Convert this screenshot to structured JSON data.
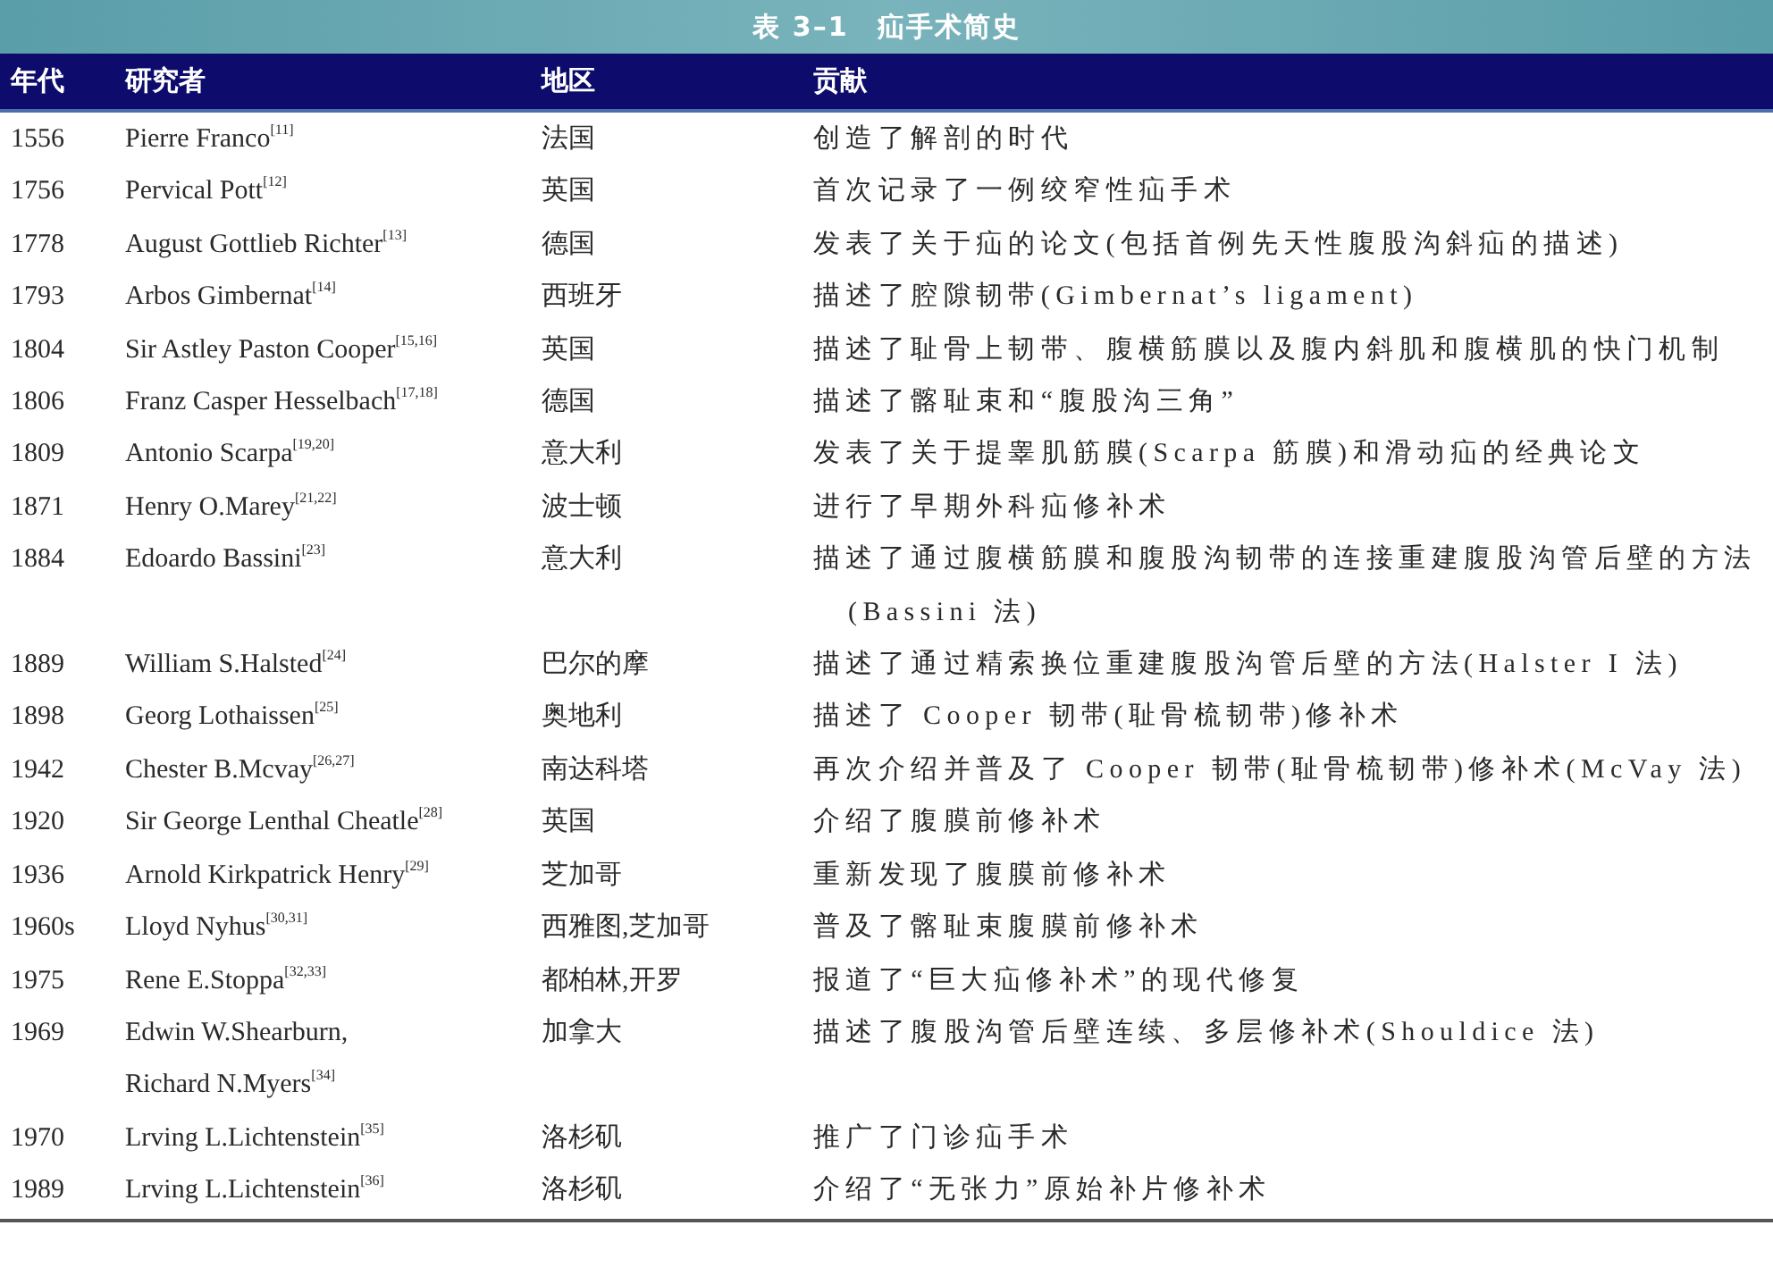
{
  "title": "表 3–1　疝手术简史",
  "columns": [
    "年代",
    "研究者",
    "地区",
    "贡献"
  ],
  "rows": [
    {
      "year": "1556",
      "researcher": "Pierre Franco$^{[11]}$",
      "region": "法国",
      "contribution": "创造了解剖的时代"
    },
    {
      "year": "1756",
      "researcher": "Pervical Pott$^{[12]}$",
      "region": "英国",
      "contribution": "首次记录了一例绞窄性疝手术"
    },
    {
      "year": "1778",
      "researcher": "August Gottlieb Richter$^{[13]}$",
      "region": "德国",
      "contribution": "发表了关于疝的论文(包括首例先天性腹股沟斜疝的描述)"
    },
    {
      "year": "1793",
      "researcher": "Arbos Gimbernat$^{[14]}$",
      "region": "西班牙",
      "contribution": "描述了腔隙韧带(Gimbernat’s ligament)"
    },
    {
      "year": "1804",
      "researcher": "Sir Astley Paston Cooper$^{[15,16]}$",
      "region": "英国",
      "contribution": "描述了耻骨上韧带、腹横筋膜以及腹内斜肌和腹横肌的快门机制"
    },
    {
      "year": "1806",
      "researcher": "Franz Casper Hesselbach$^{[17,18]}$",
      "region": "德国",
      "contribution": "描述了髂耻束和“腹股沟三角”"
    },
    {
      "year": "1809",
      "researcher": "Antonio Scarpa$^{[19,20]}$",
      "region": "意大利",
      "contribution": "发表了关于提睾肌筋膜(Scarpa 筋膜)和滑动疝的经典论文"
    },
    {
      "year": "1871",
      "researcher": "Henry O.Marey$^{[21,22]}$",
      "region": "波士顿",
      "contribution": "进行了早期外科疝修补术"
    },
    {
      "year": "1884",
      "researcher": "Edoardo Bassini$^{[23]}$",
      "region": "意大利",
      "contribution": "描述了通过腹横筋膜和腹股沟韧带的连接重建腹股沟管后壁的方法(Bassini 法)"
    },
    {
      "year": "1889",
      "researcher": "William S.Halsted$^{[24]}$",
      "region": "巴尔的摩",
      "contribution": "描述了通过精索换位重建腹股沟管后壁的方法(Halster I 法)"
    },
    {
      "year": "1898",
      "researcher": "Georg Lothaissen$^{[25]}$",
      "region": "奥地利",
      "contribution": "描述了 Cooper 韧带(耻骨梳韧带)修补术"
    },
    {
      "year": "1942",
      "researcher": "Chester B.Mcvay$^{[26,27]}$",
      "region": "南达科塔",
      "contribution": "再次介绍并普及了 Cooper 韧带(耻骨梳韧带)修补术(McVay 法)"
    },
    {
      "year": "1920",
      "researcher": "Sir George Lenthal Cheatle$^{[28]}$",
      "region": "英国",
      "contribution": "介绍了腹膜前修补术"
    },
    {
      "year": "1936",
      "researcher": "Arnold Kirkpatrick Henry$^{[29]}$",
      "region": "芝加哥",
      "contribution": "重新发现了腹膜前修补术"
    },
    {
      "year": "1960s",
      "researcher": "Lloyd Nyhus$^{[30,31]}$",
      "region": "西雅图,芝加哥",
      "contribution": "普及了髂耻束腹膜前修补术"
    },
    {
      "year": "1975",
      "researcher": "Rene E.Stoppa$^{[32,33]}$",
      "region": "都柏林,开罗",
      "contribution": "报道了“巨大疝修补术”的现代修复"
    },
    {
      "year": "1969",
      "researcher": "Edwin W.Shearburn,\nRichard N.Myers$^{[34]}$",
      "region": "加拿大",
      "contribution": "描述了腹股沟管后壁连续、多层修补术(Shouldice 法)"
    },
    {
      "year": "1970",
      "researcher": "Lrving L.Lichtenstein$^{[35]}$",
      "region": "洛杉矶",
      "contribution": "推广了门诊疝手术"
    },
    {
      "year": "1989",
      "researcher": "Lrving L.Lichtenstein$^{[36]}$",
      "region": "洛杉矶",
      "contribution": "介绍了“无张力”原始补片修补术"
    }
  ]
}
